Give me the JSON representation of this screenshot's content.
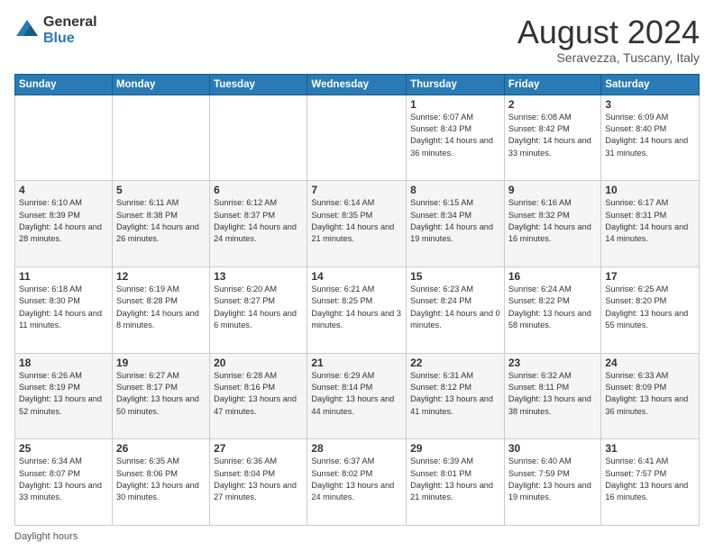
{
  "logo": {
    "general": "General",
    "blue": "Blue"
  },
  "title": "August 2024",
  "subtitle": "Seravezza, Tuscany, Italy",
  "days_of_week": [
    "Sunday",
    "Monday",
    "Tuesday",
    "Wednesday",
    "Thursday",
    "Friday",
    "Saturday"
  ],
  "footer_text": "Daylight hours",
  "weeks": [
    [
      {
        "day": "",
        "info": ""
      },
      {
        "day": "",
        "info": ""
      },
      {
        "day": "",
        "info": ""
      },
      {
        "day": "",
        "info": ""
      },
      {
        "day": "1",
        "info": "Sunrise: 6:07 AM\nSunset: 8:43 PM\nDaylight: 14 hours and 36 minutes."
      },
      {
        "day": "2",
        "info": "Sunrise: 6:08 AM\nSunset: 8:42 PM\nDaylight: 14 hours and 33 minutes."
      },
      {
        "day": "3",
        "info": "Sunrise: 6:09 AM\nSunset: 8:40 PM\nDaylight: 14 hours and 31 minutes."
      }
    ],
    [
      {
        "day": "4",
        "info": "Sunrise: 6:10 AM\nSunset: 8:39 PM\nDaylight: 14 hours and 28 minutes."
      },
      {
        "day": "5",
        "info": "Sunrise: 6:11 AM\nSunset: 8:38 PM\nDaylight: 14 hours and 26 minutes."
      },
      {
        "day": "6",
        "info": "Sunrise: 6:12 AM\nSunset: 8:37 PM\nDaylight: 14 hours and 24 minutes."
      },
      {
        "day": "7",
        "info": "Sunrise: 6:14 AM\nSunset: 8:35 PM\nDaylight: 14 hours and 21 minutes."
      },
      {
        "day": "8",
        "info": "Sunrise: 6:15 AM\nSunset: 8:34 PM\nDaylight: 14 hours and 19 minutes."
      },
      {
        "day": "9",
        "info": "Sunrise: 6:16 AM\nSunset: 8:32 PM\nDaylight: 14 hours and 16 minutes."
      },
      {
        "day": "10",
        "info": "Sunrise: 6:17 AM\nSunset: 8:31 PM\nDaylight: 14 hours and 14 minutes."
      }
    ],
    [
      {
        "day": "11",
        "info": "Sunrise: 6:18 AM\nSunset: 8:30 PM\nDaylight: 14 hours and 11 minutes."
      },
      {
        "day": "12",
        "info": "Sunrise: 6:19 AM\nSunset: 8:28 PM\nDaylight: 14 hours and 8 minutes."
      },
      {
        "day": "13",
        "info": "Sunrise: 6:20 AM\nSunset: 8:27 PM\nDaylight: 14 hours and 6 minutes."
      },
      {
        "day": "14",
        "info": "Sunrise: 6:21 AM\nSunset: 8:25 PM\nDaylight: 14 hours and 3 minutes."
      },
      {
        "day": "15",
        "info": "Sunrise: 6:23 AM\nSunset: 8:24 PM\nDaylight: 14 hours and 0 minutes."
      },
      {
        "day": "16",
        "info": "Sunrise: 6:24 AM\nSunset: 8:22 PM\nDaylight: 13 hours and 58 minutes."
      },
      {
        "day": "17",
        "info": "Sunrise: 6:25 AM\nSunset: 8:20 PM\nDaylight: 13 hours and 55 minutes."
      }
    ],
    [
      {
        "day": "18",
        "info": "Sunrise: 6:26 AM\nSunset: 8:19 PM\nDaylight: 13 hours and 52 minutes."
      },
      {
        "day": "19",
        "info": "Sunrise: 6:27 AM\nSunset: 8:17 PM\nDaylight: 13 hours and 50 minutes."
      },
      {
        "day": "20",
        "info": "Sunrise: 6:28 AM\nSunset: 8:16 PM\nDaylight: 13 hours and 47 minutes."
      },
      {
        "day": "21",
        "info": "Sunrise: 6:29 AM\nSunset: 8:14 PM\nDaylight: 13 hours and 44 minutes."
      },
      {
        "day": "22",
        "info": "Sunrise: 6:31 AM\nSunset: 8:12 PM\nDaylight: 13 hours and 41 minutes."
      },
      {
        "day": "23",
        "info": "Sunrise: 6:32 AM\nSunset: 8:11 PM\nDaylight: 13 hours and 38 minutes."
      },
      {
        "day": "24",
        "info": "Sunrise: 6:33 AM\nSunset: 8:09 PM\nDaylight: 13 hours and 36 minutes."
      }
    ],
    [
      {
        "day": "25",
        "info": "Sunrise: 6:34 AM\nSunset: 8:07 PM\nDaylight: 13 hours and 33 minutes."
      },
      {
        "day": "26",
        "info": "Sunrise: 6:35 AM\nSunset: 8:06 PM\nDaylight: 13 hours and 30 minutes."
      },
      {
        "day": "27",
        "info": "Sunrise: 6:36 AM\nSunset: 8:04 PM\nDaylight: 13 hours and 27 minutes."
      },
      {
        "day": "28",
        "info": "Sunrise: 6:37 AM\nSunset: 8:02 PM\nDaylight: 13 hours and 24 minutes."
      },
      {
        "day": "29",
        "info": "Sunrise: 6:39 AM\nSunset: 8:01 PM\nDaylight: 13 hours and 21 minutes."
      },
      {
        "day": "30",
        "info": "Sunrise: 6:40 AM\nSunset: 7:59 PM\nDaylight: 13 hours and 19 minutes."
      },
      {
        "day": "31",
        "info": "Sunrise: 6:41 AM\nSunset: 7:57 PM\nDaylight: 13 hours and 16 minutes."
      }
    ]
  ]
}
